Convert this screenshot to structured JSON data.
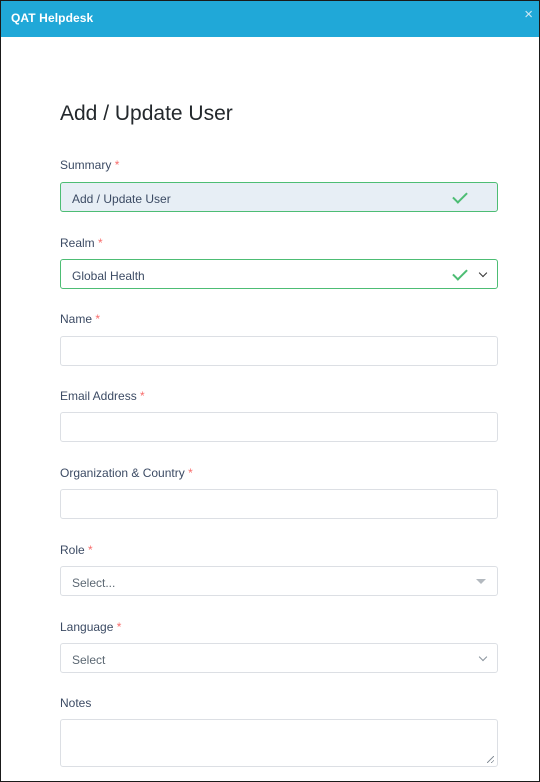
{
  "window": {
    "title": "QAT Helpdesk",
    "close_label": "×"
  },
  "form": {
    "heading": "Add / Update User",
    "required_marker": "*",
    "summary": {
      "label": "Summary",
      "value": "Add / Update User"
    },
    "realm": {
      "label": "Realm",
      "value": "Global Health"
    },
    "name": {
      "label": "Name",
      "value": ""
    },
    "email": {
      "label": "Email Address",
      "value": ""
    },
    "organization": {
      "label": "Organization & Country",
      "value": ""
    },
    "role": {
      "label": "Role",
      "placeholder": "Select..."
    },
    "language": {
      "label": "Language",
      "placeholder": "Select"
    },
    "notes": {
      "label": "Notes",
      "value": ""
    }
  },
  "colors": {
    "titlebar": "#20a8d8",
    "valid": "#4dbd74",
    "required": "#f86c6b"
  },
  "icons": [
    "close-icon",
    "check-icon",
    "chevron-down-icon",
    "caret-down-icon",
    "resize-handle-icon"
  ]
}
